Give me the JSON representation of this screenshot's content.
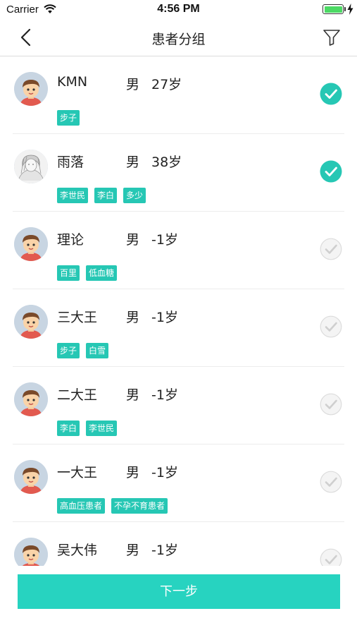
{
  "status_bar": {
    "carrier": "Carrier",
    "time": "4:56 PM",
    "battery_color": "#4cd964"
  },
  "nav": {
    "title": "患者分组",
    "back_icon": "chevron-left-icon",
    "filter_icon": "filter-icon"
  },
  "patients": [
    {
      "name": "KMN",
      "gender": "男",
      "age": "27岁",
      "avatar": "cartoon-boy",
      "tags": [
        "步子"
      ],
      "selected": true
    },
    {
      "name": "雨落",
      "gender": "男",
      "age": "38岁",
      "avatar": "sketch-portrait",
      "tags": [
        "李世民",
        "李白",
        "多少"
      ],
      "selected": true
    },
    {
      "name": "理论",
      "gender": "男",
      "age": "-1岁",
      "avatar": "cartoon-boy",
      "tags": [
        "百里",
        "低血糖"
      ],
      "selected": false
    },
    {
      "name": "三大王",
      "gender": "男",
      "age": "-1岁",
      "avatar": "cartoon-boy",
      "tags": [
        "步子",
        "白雪"
      ],
      "selected": false
    },
    {
      "name": "二大王",
      "gender": "男",
      "age": "-1岁",
      "avatar": "cartoon-boy",
      "tags": [
        "李白",
        "李世民"
      ],
      "selected": false
    },
    {
      "name": "一大王",
      "gender": "男",
      "age": "-1岁",
      "avatar": "cartoon-boy",
      "tags": [
        "高血压患者",
        "不孕不育患者"
      ],
      "selected": false
    },
    {
      "name": "吴大伟",
      "gender": "男",
      "age": "-1岁",
      "avatar": "cartoon-boy",
      "tags": [],
      "selected": false
    }
  ],
  "next_button": {
    "label": "下一步"
  },
  "colors": {
    "accent": "#26c7b4",
    "button": "#27d3c0",
    "unselected_check": "#e6e6e6"
  }
}
